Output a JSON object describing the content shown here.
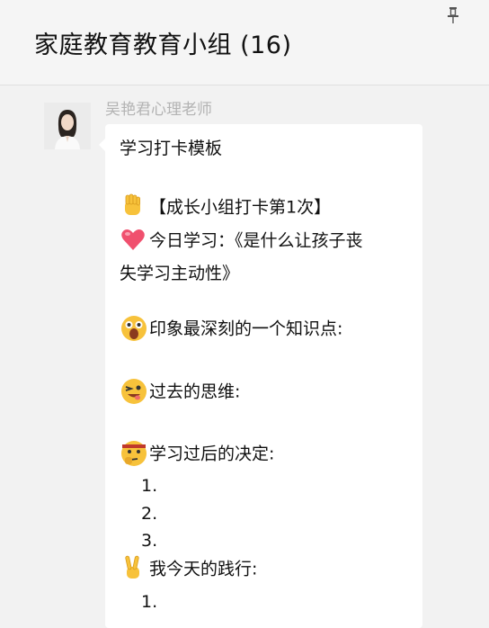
{
  "header": {
    "title": "家庭教育教育小组 (16)",
    "pin_icon": "pin-icon"
  },
  "message": {
    "sender": "吴艳君心理老师",
    "avatar": "avatar-photo",
    "lines": {
      "heading": "学习打卡模板",
      "punch": "【成长小组打卡第1次】",
      "today_1": "今日学习：《是什么让孩子丧",
      "today_2": "失学习主动性》",
      "impress": "印象最深刻的一个知识点:",
      "past": "过去的思维:",
      "decide": "学习过后的决定:",
      "n1": "1.",
      "n2": "2.",
      "n3": "3.",
      "practice": "我今天的践行:",
      "p1": "1."
    },
    "emoji_icons": [
      "raised-fist-icon",
      "heart-icon",
      "astonished-face-icon",
      "winking-tongue-face-icon",
      "thinking-face-icon",
      "victory-hand-icon"
    ]
  }
}
